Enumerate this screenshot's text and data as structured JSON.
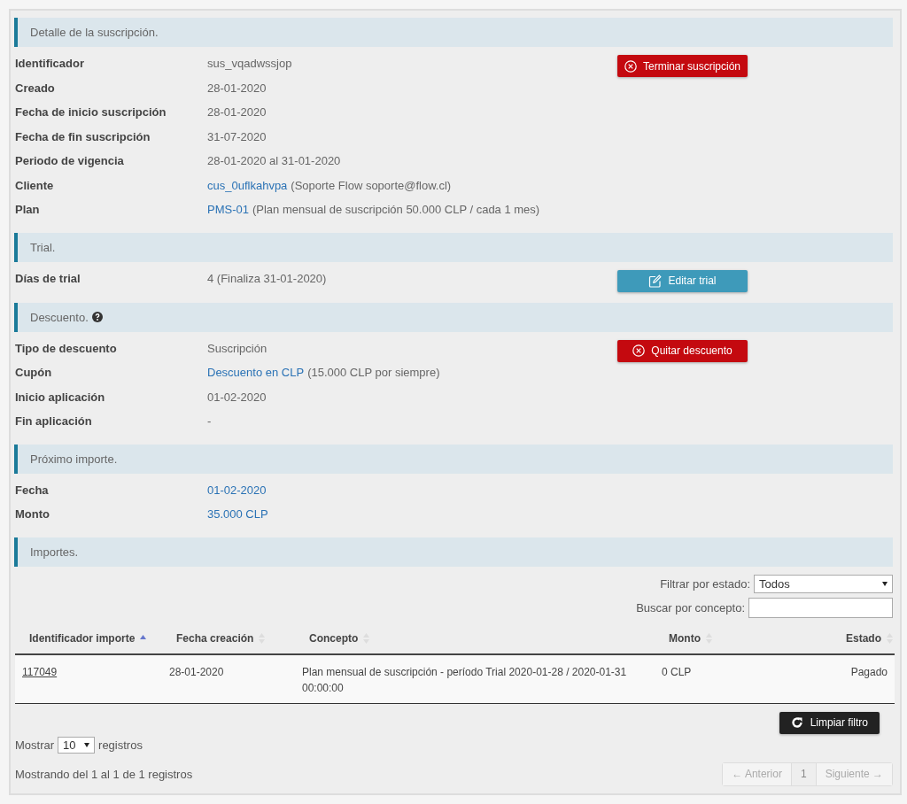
{
  "sections": [
    {
      "title": "Detalle de la suscripción.",
      "action": {
        "label": "Terminar suscripción",
        "kind": "danger"
      },
      "rows": [
        {
          "label": "Identificador",
          "value": "sus_vqadwssjop"
        },
        {
          "label": "Creado",
          "value": "28-01-2020"
        },
        {
          "label": "Fecha de inicio suscripción",
          "value": "28-01-2020"
        },
        {
          "label": "Fecha de fin suscripción",
          "value": "31-07-2020"
        },
        {
          "label": "Periodo de vigencia",
          "value": "28-01-2020 al 31-01-2020"
        },
        {
          "label": "Cliente",
          "link": "cus_0uflkahvpa",
          "value": "(Soporte Flow soporte@flow.cl)"
        },
        {
          "label": "Plan",
          "link": "PMS-01",
          "value": "(Plan mensual de suscripción 50.000 CLP / cada 1 mes)"
        }
      ]
    },
    {
      "title": "Trial.",
      "action": {
        "label": "Editar trial",
        "kind": "edit"
      },
      "rows": [
        {
          "label": "Días de trial",
          "value": "4 (Finaliza 31-01-2020)"
        }
      ]
    },
    {
      "title": "Descuento.",
      "help_icon": true,
      "action": {
        "label": "Quitar descuento",
        "kind": "danger"
      },
      "rows": [
        {
          "label": "Tipo de descuento",
          "value": "Suscripción"
        },
        {
          "label": "Cupón",
          "link": "Descuento en CLP",
          "value": "(15.000 CLP por siempre)"
        },
        {
          "label": "Inicio aplicación",
          "value": "01-02-2020"
        },
        {
          "label": "Fin aplicación",
          "value": "-"
        }
      ]
    },
    {
      "title": "Próximo importe.",
      "rows": [
        {
          "label": "Fecha",
          "link": "01-02-2020"
        },
        {
          "label": "Monto",
          "link": "35.000 CLP"
        }
      ]
    }
  ],
  "importes": {
    "title": "Importes.",
    "filter_label": "Filtrar por estado:",
    "filter_value": "Todos",
    "search_label": "Buscar por concepto:",
    "columns": [
      {
        "label": "Identificador importe",
        "sorted": true
      },
      {
        "label": "Fecha creación",
        "sorted": false
      },
      {
        "label": "Concepto",
        "sorted": false
      },
      {
        "label": "Monto",
        "sorted": false
      },
      {
        "label": "Estado",
        "sorted": false
      }
    ],
    "rows": [
      {
        "id": "117049",
        "fecha": "28-01-2020",
        "concepto": "Plan mensual de suscripción - período Trial 2020-01-28 / 2020-01-31 00:00:00",
        "monto": "0 CLP",
        "estado": "Pagado"
      }
    ],
    "clear_button": "Limpiar filtro",
    "show_label": "Mostrar",
    "show_value": "10",
    "show_suffix": "registros",
    "info": "Mostrando del 1 al 1 de 1 registros",
    "pagination": [
      {
        "label": "← Anterior",
        "disabled": true,
        "selected": false
      },
      {
        "label": "1",
        "disabled": false,
        "selected": true
      },
      {
        "label": "Siguiente →",
        "disabled": true,
        "selected": false
      }
    ]
  }
}
